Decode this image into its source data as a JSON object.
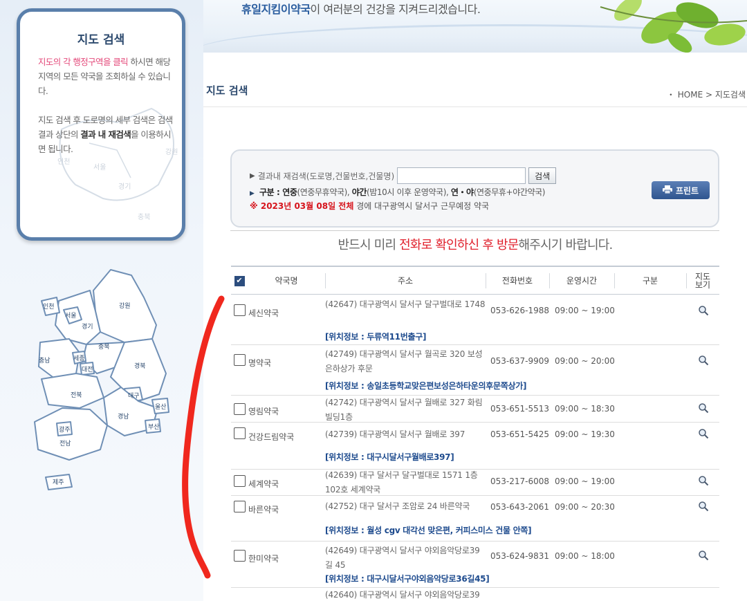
{
  "header": {
    "slogan_brand": "휴일지킴이약국",
    "slogan_rest": "이 여러분의 건강을 지켜드리겠습니다."
  },
  "sidebar": {
    "title": "지도 검색",
    "help_pink": "지도의 각 행정구역을 클릭",
    "help_rest": " 하시면 해당 지역의 모든 약국을 조회하실 수 있습니다.",
    "help2_a": "지도 검색 후 도로명의 세부 검색은 검색결과 상단의 ",
    "help2_bold": "결과 내 재검색",
    "help2_c": "을 이용하시면 됩니다.",
    "minimap_labels": [
      "인천",
      "서울",
      "강원",
      "경기",
      "충북"
    ],
    "regions": [
      "인천",
      "서울",
      "경기",
      "강원",
      "충북",
      "충남",
      "세종",
      "대전",
      "경북",
      "대구",
      "전북",
      "울산",
      "경남",
      "광주",
      "부산",
      "전남",
      "제주"
    ]
  },
  "page": {
    "title": "지도 검색",
    "breadcrumb": "HOME > 지도검색"
  },
  "search": {
    "label": "결과내 재검색(도로명,건물번호,건물명)",
    "input_value": "",
    "button": "검색",
    "legend_label": "구분 : ",
    "legend_a": "연중",
    "legend_a_desc": "(연중무휴약국), ",
    "legend_b": "야간",
    "legend_b_desc": "(밤10시 이후 운영약국), ",
    "legend_c": "연・야",
    "legend_c_desc": "(연중무휴+야간약국)",
    "date_mark": "※ 2023년 03월 08일 전체",
    "date_rest": " 경에  대구광역시  달서구   근무예정 약국",
    "print_button": "프린트"
  },
  "notice": {
    "a": "반드시 미리 ",
    "b": "전화로 확인하신 후 방문",
    "c": "해주시기 바랍니다."
  },
  "table": {
    "headers": [
      "약국명",
      "주소",
      "전화번호",
      "운영시간",
      "구분",
      "지도\n보기"
    ],
    "rows": [
      {
        "name": "세신약국",
        "address": "(42647) 대구광역시 달서구 달구벌대로 1748",
        "phone": "053-626-1988",
        "hours": "09:00 ~ 19:00",
        "location": "[위치정보 : 두류역11번출구]"
      },
      {
        "name": "명약국",
        "address": "(42749) 대구광역시 달서구 월곡로 320 보성은하상가 후문",
        "phone": "053-637-9909",
        "hours": "09:00 ~ 20:00",
        "location": "[위치정보 : 송일초등학교맞은편보성은하타운의후문쪽상가]"
      },
      {
        "name": "영림약국",
        "address": "(42742) 대구광역시 달서구 월배로 327 화림빌딩1층",
        "phone": "053-651-5513",
        "hours": "09:00 ~ 18:30",
        "location": ""
      },
      {
        "name": "건강드림약국",
        "address": "(42739) 대구광역시 달서구 월배로 397",
        "phone": "053-651-5425",
        "hours": "09:00 ~ 19:30",
        "location": "[위치정보 : 대구시달서구월배로397]"
      },
      {
        "name": "세계약국",
        "address": "(42639) 대구 달서구 달구벌대로 1571 1층 102호 세계약국",
        "phone": "053-217-6008",
        "hours": "09:00 ~ 19:00",
        "location": ""
      },
      {
        "name": "바른약국",
        "address": "(42752) 대구 달서구 조암로 24 바른약국",
        "phone": "053-643-2061",
        "hours": "09:00 ~ 20:30",
        "location": "[위치정보 : 월성 cgv 대각선 맞은편, 커피스미스 건물 안쪽]"
      },
      {
        "name": "한미약국",
        "address": "(42649) 대구광역시 달서구 야외음악당로39길 45",
        "phone": "053-624-9831",
        "hours": "09:00 ~ 18:00",
        "location": "[위치정보 : 대구시달서구야외음악당로36길45]"
      },
      {
        "name": "",
        "address": "(42640) 대구광역시 달서구 야외음악당로39",
        "phone": "",
        "hours": "",
        "location": ""
      }
    ]
  },
  "colors": {
    "accent_navy": "#2d4a6e",
    "link_blue": "#1e4b8e",
    "alert_red": "#e0202c",
    "annotation_red": "#f0281e"
  }
}
